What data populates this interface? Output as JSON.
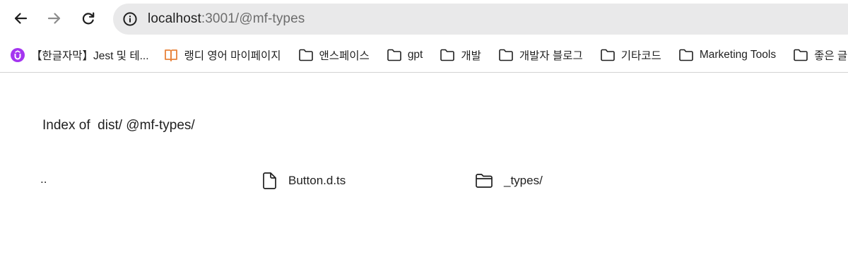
{
  "toolbar": {
    "back_icon": "arrow-left-icon",
    "forward_icon": "arrow-right-icon",
    "reload_icon": "reload-icon",
    "site_info_icon": "info-circle-icon",
    "url_host": "localhost",
    "url_rest": ":3001/@mf-types"
  },
  "bookmarks": [
    {
      "label": "【한글자막】Jest 및 테...",
      "icon": "udemy-icon"
    },
    {
      "label": "랭디 영어 마이페이지",
      "icon": "book-icon"
    },
    {
      "label": "앤스페이스",
      "icon": "folder-icon"
    },
    {
      "label": "gpt",
      "icon": "folder-icon"
    },
    {
      "label": "개발",
      "icon": "folder-icon"
    },
    {
      "label": "개발자 블로그",
      "icon": "folder-icon"
    },
    {
      "label": "기타코드",
      "icon": "folder-icon"
    },
    {
      "label": "Marketing Tools",
      "icon": "folder-icon"
    },
    {
      "label": "좋은 글",
      "icon": "folder-icon"
    }
  ],
  "page": {
    "heading": "Index of  dist/ @mf-types/",
    "entries": [
      {
        "name": "..",
        "icon": ""
      },
      {
        "name": "Button.d.ts",
        "icon": "file-icon"
      },
      {
        "name": "_types/",
        "icon": "folder-icon"
      }
    ]
  },
  "colors": {
    "omnibox_bg": "#e9e9ea",
    "udemy_purple": "#a435f0",
    "book_orange": "#e8823a"
  }
}
